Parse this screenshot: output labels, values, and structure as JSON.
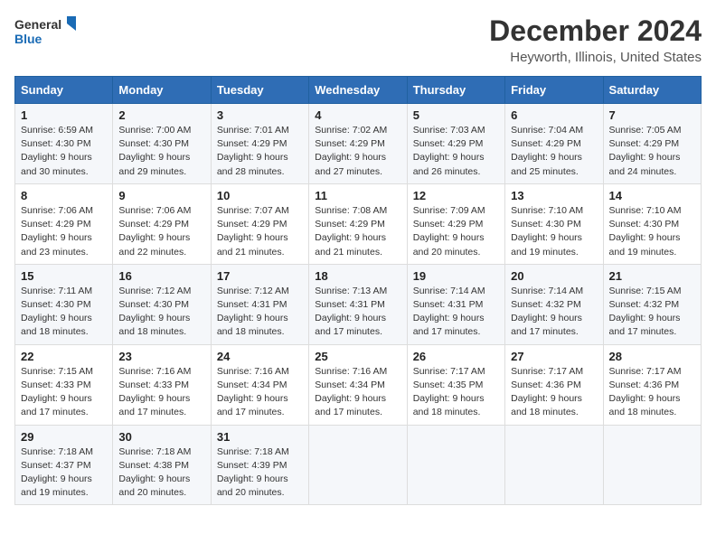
{
  "header": {
    "logo_line1": "General",
    "logo_line2": "Blue",
    "title": "December 2024",
    "subtitle": "Heyworth, Illinois, United States"
  },
  "columns": [
    "Sunday",
    "Monday",
    "Tuesday",
    "Wednesday",
    "Thursday",
    "Friday",
    "Saturday"
  ],
  "weeks": [
    [
      {
        "day": "1",
        "sunrise": "Sunrise: 6:59 AM",
        "sunset": "Sunset: 4:30 PM",
        "daylight": "Daylight: 9 hours and 30 minutes."
      },
      {
        "day": "2",
        "sunrise": "Sunrise: 7:00 AM",
        "sunset": "Sunset: 4:30 PM",
        "daylight": "Daylight: 9 hours and 29 minutes."
      },
      {
        "day": "3",
        "sunrise": "Sunrise: 7:01 AM",
        "sunset": "Sunset: 4:29 PM",
        "daylight": "Daylight: 9 hours and 28 minutes."
      },
      {
        "day": "4",
        "sunrise": "Sunrise: 7:02 AM",
        "sunset": "Sunset: 4:29 PM",
        "daylight": "Daylight: 9 hours and 27 minutes."
      },
      {
        "day": "5",
        "sunrise": "Sunrise: 7:03 AM",
        "sunset": "Sunset: 4:29 PM",
        "daylight": "Daylight: 9 hours and 26 minutes."
      },
      {
        "day": "6",
        "sunrise": "Sunrise: 7:04 AM",
        "sunset": "Sunset: 4:29 PM",
        "daylight": "Daylight: 9 hours and 25 minutes."
      },
      {
        "day": "7",
        "sunrise": "Sunrise: 7:05 AM",
        "sunset": "Sunset: 4:29 PM",
        "daylight": "Daylight: 9 hours and 24 minutes."
      }
    ],
    [
      {
        "day": "8",
        "sunrise": "Sunrise: 7:06 AM",
        "sunset": "Sunset: 4:29 PM",
        "daylight": "Daylight: 9 hours and 23 minutes."
      },
      {
        "day": "9",
        "sunrise": "Sunrise: 7:06 AM",
        "sunset": "Sunset: 4:29 PM",
        "daylight": "Daylight: 9 hours and 22 minutes."
      },
      {
        "day": "10",
        "sunrise": "Sunrise: 7:07 AM",
        "sunset": "Sunset: 4:29 PM",
        "daylight": "Daylight: 9 hours and 21 minutes."
      },
      {
        "day": "11",
        "sunrise": "Sunrise: 7:08 AM",
        "sunset": "Sunset: 4:29 PM",
        "daylight": "Daylight: 9 hours and 21 minutes."
      },
      {
        "day": "12",
        "sunrise": "Sunrise: 7:09 AM",
        "sunset": "Sunset: 4:29 PM",
        "daylight": "Daylight: 9 hours and 20 minutes."
      },
      {
        "day": "13",
        "sunrise": "Sunrise: 7:10 AM",
        "sunset": "Sunset: 4:30 PM",
        "daylight": "Daylight: 9 hours and 19 minutes."
      },
      {
        "day": "14",
        "sunrise": "Sunrise: 7:10 AM",
        "sunset": "Sunset: 4:30 PM",
        "daylight": "Daylight: 9 hours and 19 minutes."
      }
    ],
    [
      {
        "day": "15",
        "sunrise": "Sunrise: 7:11 AM",
        "sunset": "Sunset: 4:30 PM",
        "daylight": "Daylight: 9 hours and 18 minutes."
      },
      {
        "day": "16",
        "sunrise": "Sunrise: 7:12 AM",
        "sunset": "Sunset: 4:30 PM",
        "daylight": "Daylight: 9 hours and 18 minutes."
      },
      {
        "day": "17",
        "sunrise": "Sunrise: 7:12 AM",
        "sunset": "Sunset: 4:31 PM",
        "daylight": "Daylight: 9 hours and 18 minutes."
      },
      {
        "day": "18",
        "sunrise": "Sunrise: 7:13 AM",
        "sunset": "Sunset: 4:31 PM",
        "daylight": "Daylight: 9 hours and 17 minutes."
      },
      {
        "day": "19",
        "sunrise": "Sunrise: 7:14 AM",
        "sunset": "Sunset: 4:31 PM",
        "daylight": "Daylight: 9 hours and 17 minutes."
      },
      {
        "day": "20",
        "sunrise": "Sunrise: 7:14 AM",
        "sunset": "Sunset: 4:32 PM",
        "daylight": "Daylight: 9 hours and 17 minutes."
      },
      {
        "day": "21",
        "sunrise": "Sunrise: 7:15 AM",
        "sunset": "Sunset: 4:32 PM",
        "daylight": "Daylight: 9 hours and 17 minutes."
      }
    ],
    [
      {
        "day": "22",
        "sunrise": "Sunrise: 7:15 AM",
        "sunset": "Sunset: 4:33 PM",
        "daylight": "Daylight: 9 hours and 17 minutes."
      },
      {
        "day": "23",
        "sunrise": "Sunrise: 7:16 AM",
        "sunset": "Sunset: 4:33 PM",
        "daylight": "Daylight: 9 hours and 17 minutes."
      },
      {
        "day": "24",
        "sunrise": "Sunrise: 7:16 AM",
        "sunset": "Sunset: 4:34 PM",
        "daylight": "Daylight: 9 hours and 17 minutes."
      },
      {
        "day": "25",
        "sunrise": "Sunrise: 7:16 AM",
        "sunset": "Sunset: 4:34 PM",
        "daylight": "Daylight: 9 hours and 17 minutes."
      },
      {
        "day": "26",
        "sunrise": "Sunrise: 7:17 AM",
        "sunset": "Sunset: 4:35 PM",
        "daylight": "Daylight: 9 hours and 18 minutes."
      },
      {
        "day": "27",
        "sunrise": "Sunrise: 7:17 AM",
        "sunset": "Sunset: 4:36 PM",
        "daylight": "Daylight: 9 hours and 18 minutes."
      },
      {
        "day": "28",
        "sunrise": "Sunrise: 7:17 AM",
        "sunset": "Sunset: 4:36 PM",
        "daylight": "Daylight: 9 hours and 18 minutes."
      }
    ],
    [
      {
        "day": "29",
        "sunrise": "Sunrise: 7:18 AM",
        "sunset": "Sunset: 4:37 PM",
        "daylight": "Daylight: 9 hours and 19 minutes."
      },
      {
        "day": "30",
        "sunrise": "Sunrise: 7:18 AM",
        "sunset": "Sunset: 4:38 PM",
        "daylight": "Daylight: 9 hours and 20 minutes."
      },
      {
        "day": "31",
        "sunrise": "Sunrise: 7:18 AM",
        "sunset": "Sunset: 4:39 PM",
        "daylight": "Daylight: 9 hours and 20 minutes."
      },
      null,
      null,
      null,
      null
    ]
  ]
}
